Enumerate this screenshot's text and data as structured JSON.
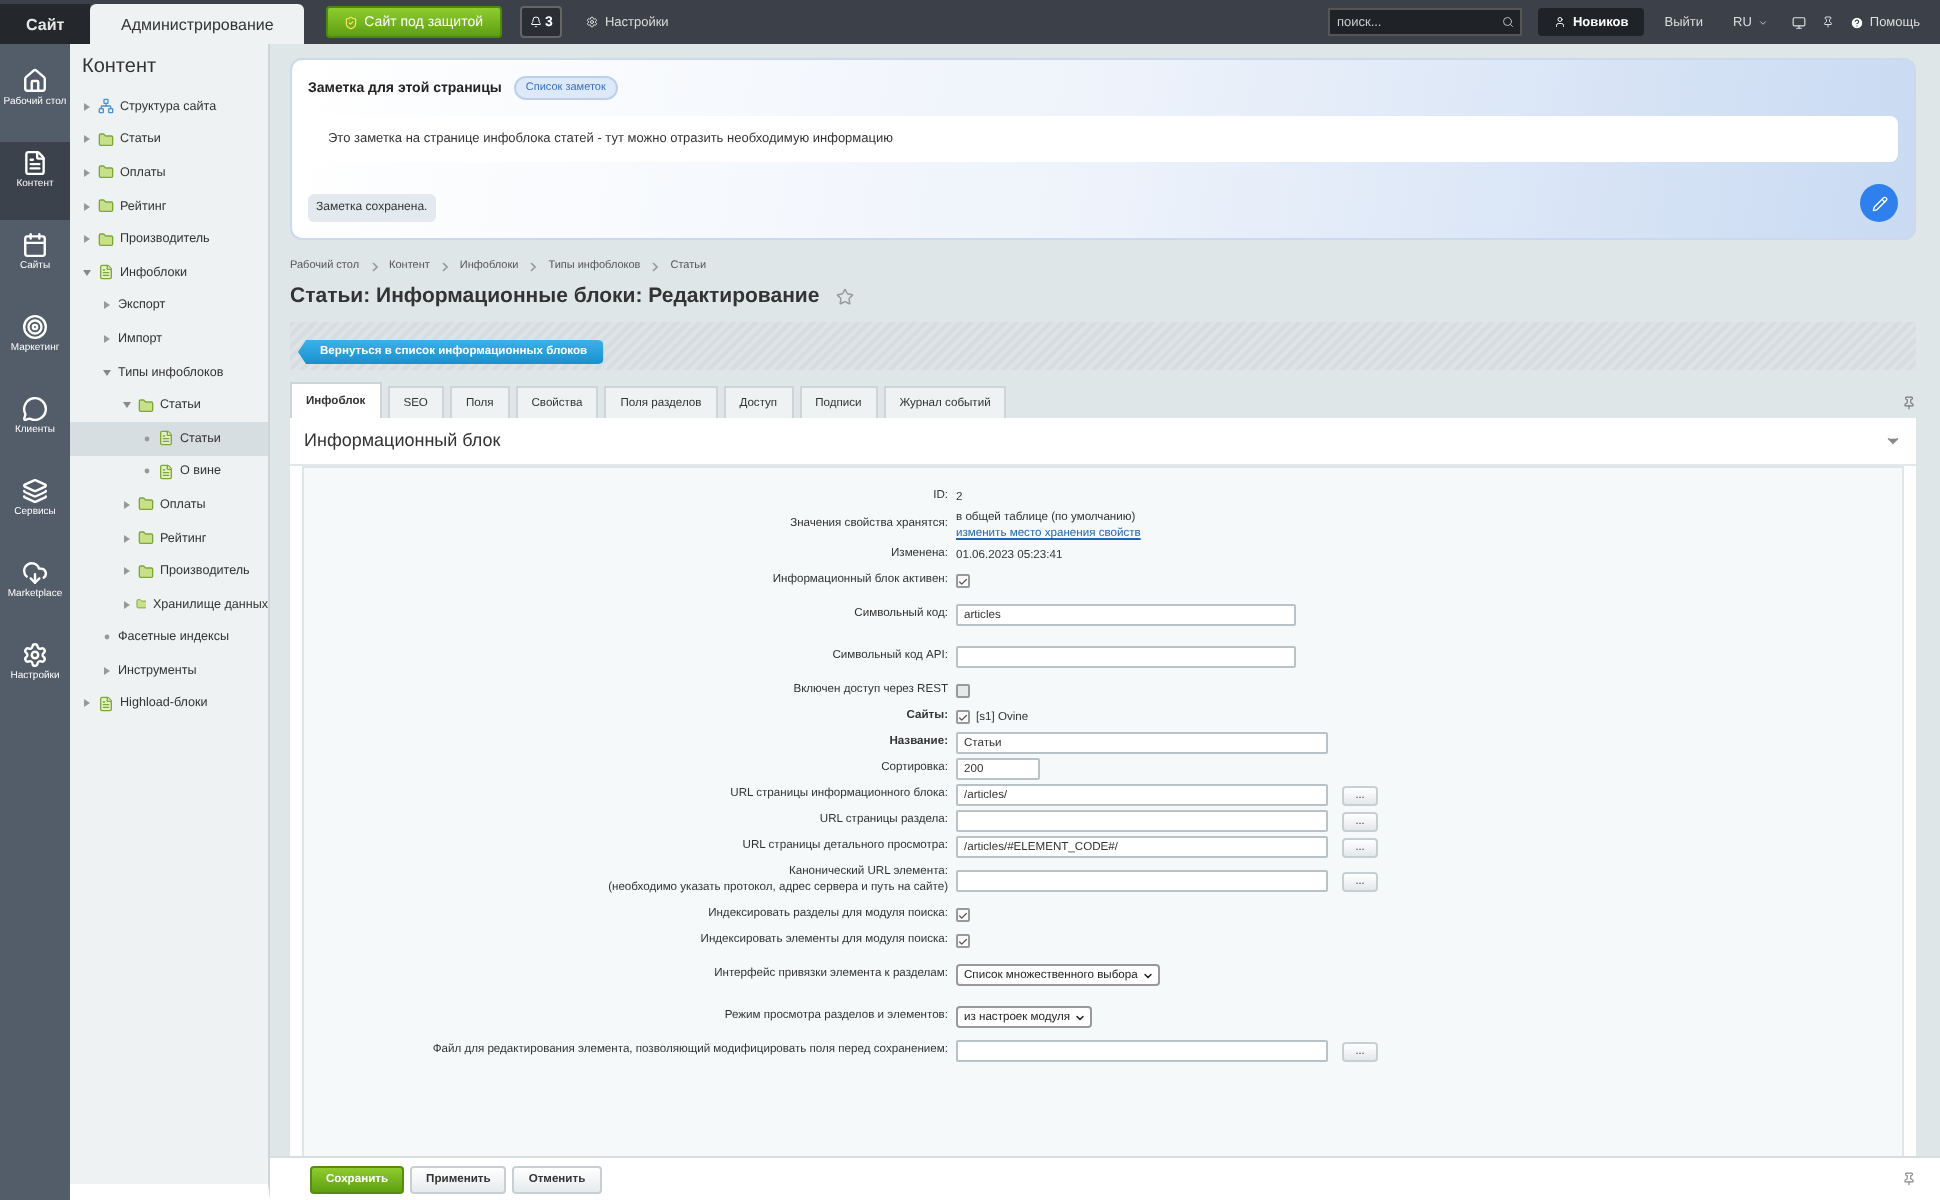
{
  "topbar": {
    "tabs": [
      {
        "label": "Сайт",
        "selected": false
      },
      {
        "label": "Администрирование",
        "selected": true
      }
    ],
    "protect_button": "Сайт под защитой",
    "notice_count": "3",
    "settings": "Настройки",
    "search": {
      "placeholder": "поиск..."
    },
    "user": "Новиков",
    "logout": "Выйти",
    "lang": "RU",
    "help": "Помощь"
  },
  "rail": [
    {
      "kind": "home",
      "label": "Рабочий стол",
      "selected": false
    },
    {
      "kind": "content",
      "label": "Контент",
      "selected": true
    },
    {
      "kind": "sites",
      "label": "Сайты",
      "selected": false
    },
    {
      "kind": "marketing",
      "label": "Маркетинг",
      "selected": false
    },
    {
      "kind": "clients",
      "label": "Клиенты",
      "selected": false
    },
    {
      "kind": "services",
      "label": "Сервисы",
      "selected": false
    },
    {
      "kind": "market",
      "label": "Marketplace",
      "selected": false
    },
    {
      "kind": "settings",
      "label": "Настройки",
      "selected": false
    }
  ],
  "tree": {
    "title": "Контент",
    "items": [
      {
        "label": "Структура сайта",
        "kind": "structure",
        "expanded": false,
        "selected": false
      },
      {
        "label": "Статьи",
        "kind": "iblock",
        "expanded": false,
        "selected": false
      },
      {
        "label": "Оплаты",
        "kind": "iblock",
        "expanded": false,
        "selected": false
      },
      {
        "label": "Рейтинг",
        "kind": "iblock",
        "expanded": false,
        "selected": false
      },
      {
        "label": "Производитель",
        "kind": "iblock",
        "expanded": false,
        "selected": false
      },
      {
        "label": "Инфоблоки",
        "kind": "type",
        "expanded": true,
        "selected": false,
        "children": [
          {
            "label": "Экспорт",
            "kind": "group",
            "expanded": false,
            "selected": false
          },
          {
            "label": "Импорт",
            "kind": "group",
            "expanded": false,
            "selected": false
          },
          {
            "label": "Типы инфоблоков",
            "kind": "group",
            "expanded": true,
            "selected": false,
            "children": [
              {
                "label": "Статьи",
                "kind": "iblock",
                "expanded": true,
                "selected": false,
                "children": [
                  {
                    "label": "Статьи",
                    "kind": "element",
                    "selected": true
                  },
                  {
                    "label": "О вине",
                    "kind": "element",
                    "selected": false
                  }
                ]
              },
              {
                "label": "Оплаты",
                "kind": "iblock",
                "expanded": false,
                "selected": false
              },
              {
                "label": "Рейтинг",
                "kind": "iblock",
                "expanded": false,
                "selected": false
              },
              {
                "label": "Производитель",
                "kind": "iblock",
                "expanded": false,
                "selected": false
              },
              {
                "label": "Хранилище данных",
                "kind": "iblock",
                "expanded": false,
                "selected": false
              }
            ]
          },
          {
            "label": "Фасетные индексы",
            "kind": "tool",
            "selected": false
          },
          {
            "label": "Инструменты",
            "kind": "group",
            "expanded": false,
            "selected": false
          }
        ]
      },
      {
        "label": "Highload-блоки",
        "kind": "type",
        "expanded": false,
        "selected": false
      }
    ]
  },
  "note": {
    "title": "Заметка для этой страницы",
    "list_button": "Список заметок",
    "text": "Это заметка на странице инфоблока статей - тут можно отразить необходимую информацию",
    "status": "Заметка сохранена."
  },
  "breadcrumbs": [
    "Рабочий стол",
    "Контент",
    "Инфоблоки",
    "Типы инфоблоков",
    "Статьи"
  ],
  "title": "Статьи: Информационные блоки: Редактирование",
  "back_button": "Вернуться в список информационных блоков",
  "tabs": [
    {
      "label": "Инфоблок",
      "selected": true
    },
    {
      "label": "SEO",
      "selected": false
    },
    {
      "label": "Поля",
      "selected": false
    },
    {
      "label": "Свойства",
      "selected": false
    },
    {
      "label": "Поля разделов",
      "selected": false
    },
    {
      "label": "Доступ",
      "selected": false
    },
    {
      "label": "Подписи",
      "selected": false
    },
    {
      "label": "Журнал событий",
      "selected": false
    }
  ],
  "section_title": "Информационный блок",
  "form": [
    {
      "label": "ID:",
      "kind": "text",
      "value": "2",
      "bold": false
    },
    {
      "label": "Значения свойства хранятся:",
      "kind": "link",
      "value": "в общей таблице (по умолчанию)",
      "link": "изменить место хранения свойств",
      "bold": false
    },
    {
      "label": "Изменена:",
      "kind": "text",
      "value": "01.06.2023 05:23:41",
      "bold": false
    },
    {
      "label": "Информационный блок активен:",
      "kind": "checkbox",
      "checked": true,
      "bold": false
    },
    {
      "label": "Символьный код:",
      "kind": "input",
      "value": "articles",
      "bold": false
    },
    {
      "label": "Символьный код API:",
      "kind": "input",
      "bold": false
    },
    {
      "label": "Включен доступ через REST",
      "kind": "checkbox",
      "checked": false,
      "bold": false
    },
    {
      "label": "Сайты:",
      "kind": "checkbox",
      "checked": true,
      "note": "[s1] Ovine",
      "bold": true
    },
    {
      "label": "Название:",
      "kind": "wide",
      "value": "Статьи",
      "bold": true
    },
    {
      "label": "Сортировка:",
      "kind": "short",
      "value": "200",
      "bold": false
    },
    {
      "label": "URL страницы информационного блока:",
      "kind": "browse",
      "value": "/articles/",
      "button": "...",
      "bold": false
    },
    {
      "label": "URL страницы раздела:",
      "kind": "browse",
      "button": "...",
      "bold": false
    },
    {
      "label": "URL страницы детального просмотра:",
      "kind": "browse",
      "value": "/articles/#ELEMENT_CODE#/",
      "button": "...",
      "bold": false
    },
    {
      "label": "Канонический URL элемента:",
      "label_note": "(необходимо указать протокол, адрес сервера и путь на сайте)",
      "kind": "browse",
      "button": "...",
      "bold": false
    },
    {
      "label": "Индексировать разделы для модуля поиска:",
      "kind": "checkbox",
      "checked": true,
      "bold": false
    },
    {
      "label": "Индексировать элементы для модуля поиска:",
      "kind": "checkbox",
      "checked": true,
      "bold": false
    },
    {
      "label": "Интерфейс привязки элемента к разделам:",
      "kind": "select",
      "value": "Список множественного выбора",
      "bold": false
    },
    {
      "label": "Режим просмотра разделов и элементов:",
      "kind": "select",
      "value": "из настроек модуля",
      "bold": false
    },
    {
      "label": "Файл для редактирования элемента, позволяющий модифицировать поля перед сохранением:",
      "kind": "browse",
      "button": "...",
      "bold": false
    }
  ],
  "footer": {
    "buttons": [
      {
        "label": "Сохранить",
        "kind": "primary"
      },
      {
        "label": "Применить",
        "kind": "plain"
      },
      {
        "label": "Отменить",
        "kind": "plain"
      }
    ]
  }
}
